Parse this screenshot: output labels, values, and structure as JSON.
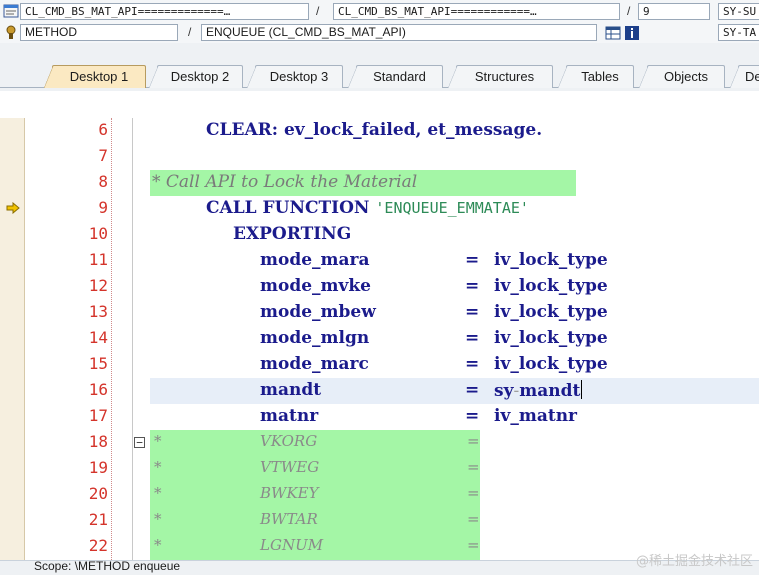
{
  "header": {
    "row1": {
      "field1": "CL_CMD_BS_MAT_API=============…",
      "sep1": "/",
      "field2": "CL_CMD_BS_MAT_API============…",
      "sep2": "/",
      "field3": "9",
      "field4": "SY-SU"
    },
    "row2": {
      "type": "METHOD",
      "sep": "/",
      "name": "ENQUEUE (CL_CMD_BS_MAT_API)",
      "field4": "SY-TA"
    }
  },
  "tabs": [
    "Desktop 1",
    "Desktop 2",
    "Desktop 3",
    "Standard",
    "Structures",
    "Tables",
    "Objects",
    "De"
  ],
  "active_tab": "Desktop 1",
  "code": {
    "l6": {
      "num": "6",
      "a": "CLEAR:",
      "b": " ev_lock_failed, et_message."
    },
    "l7": {
      "num": "7"
    },
    "l8": {
      "num": "8",
      "text": "* Call API to Lock the Material"
    },
    "l9": {
      "num": "9",
      "a": "CALL FUNCTION ",
      "s": "'ENQUEUE_EMMATAE'"
    },
    "l10": {
      "num": "10",
      "a": "EXPORTING"
    },
    "l11": {
      "num": "11",
      "param": "mode_mara",
      "eq": "=",
      "val": "iv_lock_type"
    },
    "l12": {
      "num": "12",
      "param": "mode_mvke",
      "eq": "=",
      "val": "iv_lock_type"
    },
    "l13": {
      "num": "13",
      "param": "mode_mbew",
      "eq": "=",
      "val": "iv_lock_type"
    },
    "l14": {
      "num": "14",
      "param": "mode_mlgn",
      "eq": "=",
      "val": "iv_lock_type"
    },
    "l15": {
      "num": "15",
      "param": "mode_marc",
      "eq": "=",
      "val": "iv_lock_type"
    },
    "l16": {
      "num": "16",
      "param": "mandt",
      "eq": "=",
      "val1": "sy",
      "dash": "-",
      "val2": "mandt"
    },
    "l17": {
      "num": "17",
      "param": "matnr",
      "eq": "=",
      "val": "iv_matnr"
    },
    "l18": {
      "num": "18",
      "star": "*",
      "param": "VKORG",
      "eq": "="
    },
    "l19": {
      "num": "19",
      "star": "*",
      "param": "VTWEG",
      "eq": "="
    },
    "l20": {
      "num": "20",
      "star": "*",
      "param": "BWKEY",
      "eq": "="
    },
    "l21": {
      "num": "21",
      "star": "*",
      "param": "BWTAR",
      "eq": "="
    },
    "l22": {
      "num": "22",
      "star": "*",
      "param": "LGNUM",
      "eq": "="
    }
  },
  "fold_symbol": "−",
  "status": "Scope: \\METHOD enqueue",
  "watermark": "@稀土掘金技术社区"
}
